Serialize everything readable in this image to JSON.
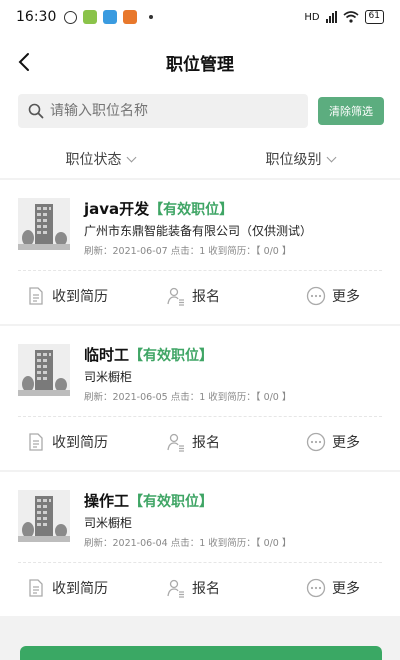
{
  "status_bar": {
    "time": "16:30",
    "battery": "61",
    "network": "HD"
  },
  "header": {
    "title": "职位管理"
  },
  "search": {
    "placeholder": "请输入职位名称",
    "clear_label": "清除筛选"
  },
  "filters": [
    {
      "label": "职位状态"
    },
    {
      "label": "职位级别"
    }
  ],
  "jobs": [
    {
      "title": "java开发",
      "status": "【有效职位】",
      "company": "广州市东鼎智能装备有限公司（仅供测试）",
      "meta": "刷新：2021-06-07 点击：1 收到简历：【 0/0 】"
    },
    {
      "title": "临时工",
      "status": "【有效职位】",
      "company": "司米橱柜",
      "meta": "刷新：2021-06-05 点击：1 收到简历：【 0/0 】"
    },
    {
      "title": "操作工",
      "status": "【有效职位】",
      "company": "司米橱柜",
      "meta": "刷新：2021-06-04 点击：1 收到简历：【 0/0 】"
    }
  ],
  "actions": {
    "resumes": "收到简历",
    "apply": "报名",
    "more": "更多"
  },
  "colors": {
    "accent": "#3aa864",
    "status_green": "#3fa565",
    "clear_button": "#5cad7f"
  }
}
